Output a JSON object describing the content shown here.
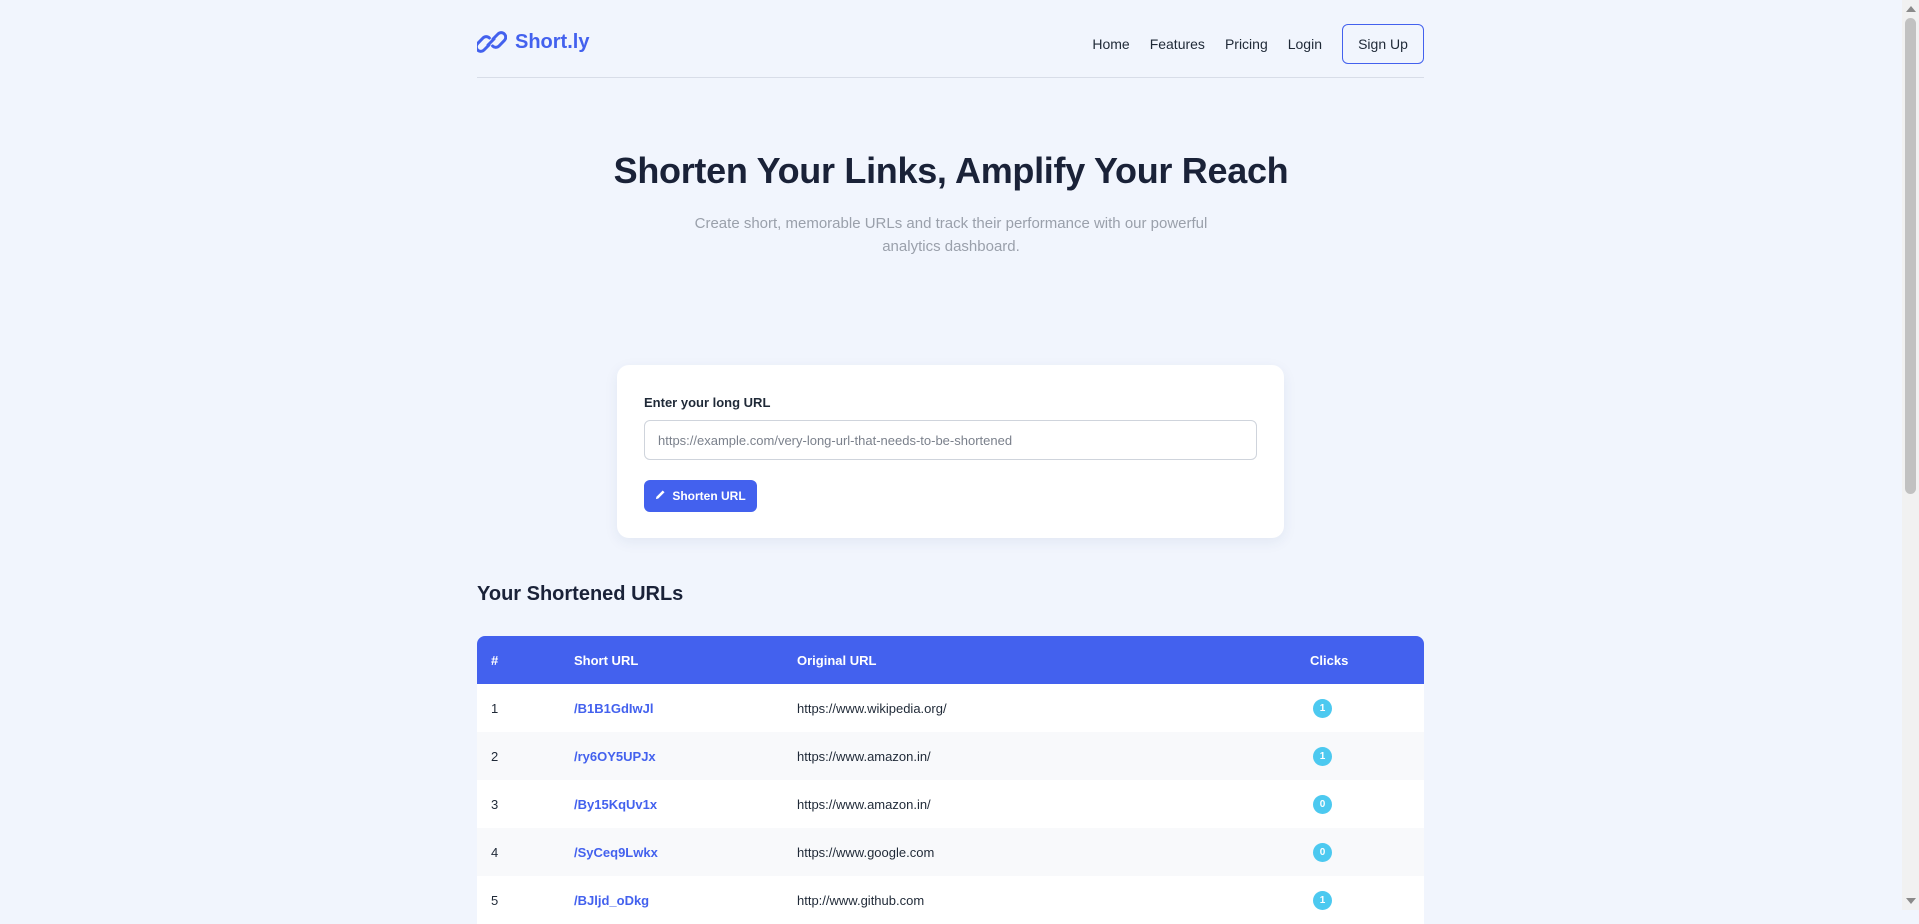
{
  "brand": {
    "name": "Short.ly",
    "icon": "link-icon",
    "color": "#4361ee"
  },
  "nav": {
    "links": [
      "Home",
      "Features",
      "Pricing",
      "Login"
    ],
    "signup_label": "Sign Up"
  },
  "hero": {
    "title": "Shorten Your Links, Amplify Your Reach",
    "subtitle": "Create short, memorable URLs and track their performance with our powerful analytics dashboard."
  },
  "form": {
    "label": "Enter your long URL",
    "input_value": "",
    "placeholder": "https://example.com/very-long-url-that-needs-to-be-shortened",
    "button_label": "Shorten URL",
    "button_icon": "pencil-icon"
  },
  "urls": {
    "title": "Your Shortened URLs",
    "columns": [
      "#",
      "Short URL",
      "Original URL",
      "Clicks"
    ],
    "rows": [
      {
        "num": "1",
        "short": "/B1B1GdIwJl",
        "original": "https://www.wikipedia.org/",
        "clicks": "1"
      },
      {
        "num": "2",
        "short": "/ry6OY5UPJx",
        "original": "https://www.amazon.in/",
        "clicks": "1"
      },
      {
        "num": "3",
        "short": "/By15KqUv1x",
        "original": "https://www.amazon.in/",
        "clicks": "0"
      },
      {
        "num": "4",
        "short": "/SyCeq9Lwkx",
        "original": "https://www.google.com",
        "clicks": "0"
      },
      {
        "num": "5",
        "short": "/BJljd_oDkg",
        "original": "http://www.github.com",
        "clicks": "1"
      }
    ]
  },
  "colors": {
    "accent": "#4361ee",
    "badge": "#4cc9f0",
    "background": "#f1f5fd"
  }
}
